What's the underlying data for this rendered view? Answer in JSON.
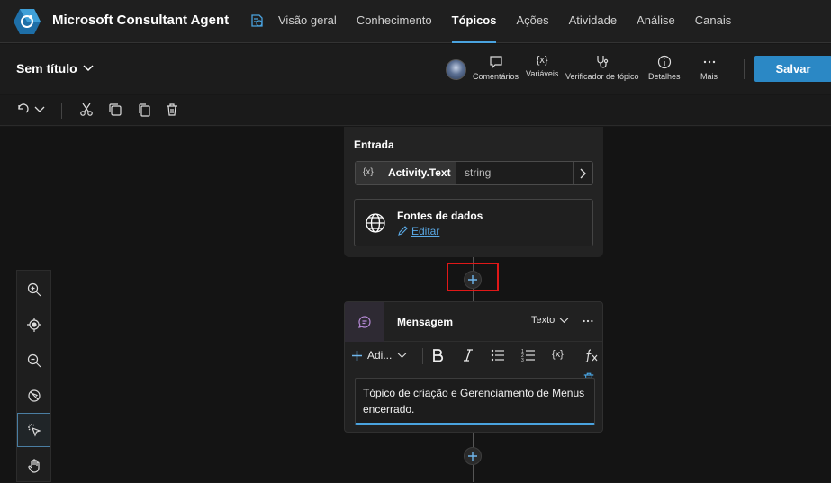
{
  "app": {
    "title": "Microsoft Consultant Agent"
  },
  "nav": {
    "tabs": [
      {
        "label": "Visão geral"
      },
      {
        "label": "Conhecimento"
      },
      {
        "label": "Tópicos",
        "active": true
      },
      {
        "label": "Ações"
      },
      {
        "label": "Atividade"
      },
      {
        "label": "Análise"
      },
      {
        "label": "Canais"
      }
    ]
  },
  "topic": {
    "name": "Sem título"
  },
  "tools": {
    "comments": "Comentários",
    "variables": "Variáveis",
    "checker": "Verificador de tópico",
    "details": "Detalhes",
    "more": "Mais",
    "save": "Salvar"
  },
  "trigger": {
    "section_label": "Entrada",
    "variable": {
      "icon": "{x}",
      "name": "Activity.Text",
      "type": "string"
    },
    "datasources": {
      "title": "Fontes de dados",
      "edit_label": "Editar"
    }
  },
  "message": {
    "title": "Mensagem",
    "type": "Texto",
    "add_label": "Adi...",
    "var_icon": "{x}",
    "text": "Tópico de criação e Gerenciamento de Menus encerrado."
  },
  "colors": {
    "accent": "#2b88c5",
    "highlight": "#e01818",
    "background": "#141414"
  },
  "icons": [
    "app-logo-icon",
    "certificate-icon",
    "chevron-down-icon",
    "comment-icon",
    "variable-icon",
    "stethoscope-icon",
    "info-icon",
    "more-icon",
    "undo-icon",
    "cut-icon",
    "copy-icon",
    "paste-icon",
    "delete-icon",
    "globe-icon",
    "pencil-icon",
    "plus-icon",
    "chat-icon",
    "bold-icon",
    "italic-icon",
    "bullet-list-icon",
    "numbered-list-icon",
    "formula-icon",
    "trash-icon",
    "zoom-in-icon",
    "recenter-icon",
    "zoom-out-icon",
    "minimap-off-icon",
    "select-cursor-icon",
    "hand-pan-icon"
  ]
}
